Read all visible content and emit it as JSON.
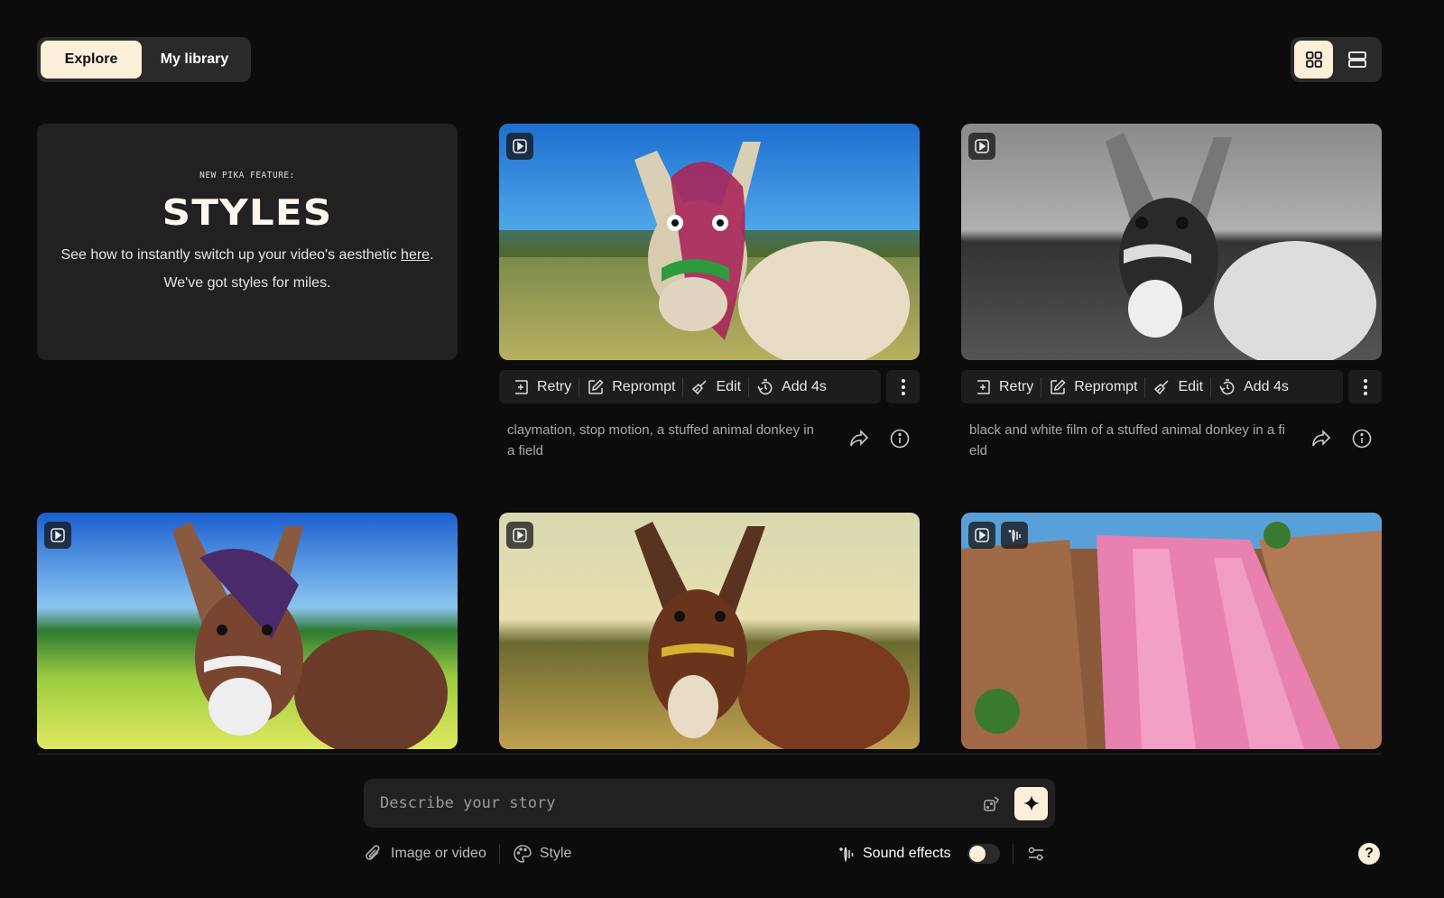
{
  "nav": {
    "tabs": [
      {
        "label": "Explore",
        "active": true
      },
      {
        "label": "My library",
        "active": false
      }
    ],
    "view_modes": [
      {
        "icon": "grid-icon",
        "active": true
      },
      {
        "icon": "list-icon",
        "active": false
      }
    ]
  },
  "promo": {
    "kicker": "NEW PIKA FEATURE:",
    "title": "STYLES",
    "text_before_link": "See how to instantly switch up your video's aesthetic ",
    "link_text": "here",
    "text_after_link": ".",
    "text2": "We've got styles for miles."
  },
  "actions": {
    "retry": "Retry",
    "reprompt": "Reprompt",
    "edit": "Edit",
    "add": "Add 4s"
  },
  "videos": [
    {
      "prompt": "claymation, stop motion, a stuffed animal donkey in a field",
      "style": "claymation",
      "has_sound": false
    },
    {
      "prompt": "black and white film of a stuffed animal donkey in a field",
      "style": "bw",
      "has_sound": false
    },
    {
      "prompt": "",
      "style": "anime",
      "has_sound": false
    },
    {
      "prompt": "",
      "style": "realistic",
      "has_sound": false
    },
    {
      "prompt": "",
      "style": "waterfall",
      "has_sound": true
    }
  ],
  "composer": {
    "placeholder": "Describe your story",
    "image_or_video": "Image or video",
    "style": "Style",
    "sound_effects": "Sound effects",
    "sound_effects_on": false
  },
  "colors": {
    "accent": "#fdefd9",
    "background": "#0c0c0c",
    "surface": "#212121"
  }
}
